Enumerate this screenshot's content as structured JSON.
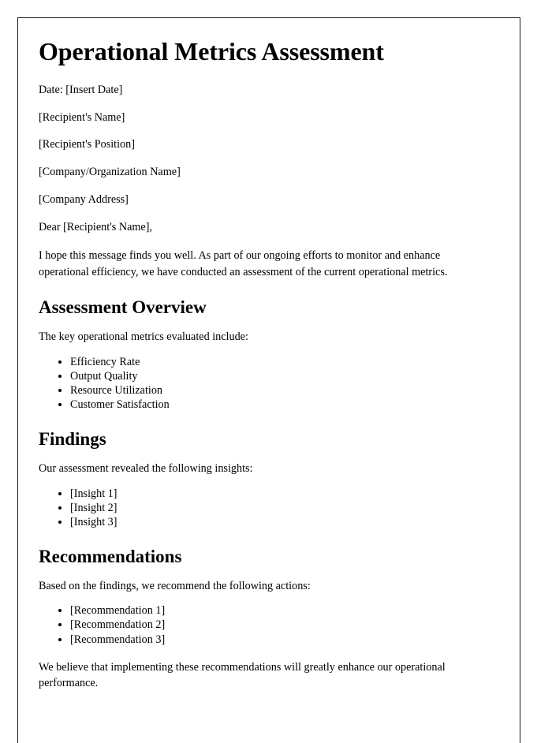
{
  "document": {
    "title": "Operational Metrics Assessment",
    "date_line": "Date: [Insert Date]",
    "recipient_name": "[Recipient's Name]",
    "recipient_position": "[Recipient's Position]",
    "company_name": "[Company/Organization Name]",
    "company_address": "[Company Address]",
    "salutation": "Dear [Recipient's Name],",
    "intro_paragraph": "I hope this message finds you well. As part of our ongoing efforts to monitor and enhance operational efficiency, we have conducted an assessment of the current operational metrics.",
    "sections": [
      {
        "heading": "Assessment Overview",
        "lead_in": "The key operational metrics evaluated include:",
        "items": [
          "Efficiency Rate",
          "Output Quality",
          "Resource Utilization",
          "Customer Satisfaction"
        ]
      },
      {
        "heading": "Findings",
        "lead_in": "Our assessment revealed the following insights:",
        "items": [
          "[Insight 1]",
          "[Insight 2]",
          "[Insight 3]"
        ]
      },
      {
        "heading": "Recommendations",
        "lead_in": "Based on the findings, we recommend the following actions:",
        "items": [
          "[Recommendation 1]",
          "[Recommendation 2]",
          "[Recommendation 3]"
        ]
      }
    ],
    "closing_paragraph": "We believe that implementing these recommendations will greatly enhance our operational performance."
  }
}
